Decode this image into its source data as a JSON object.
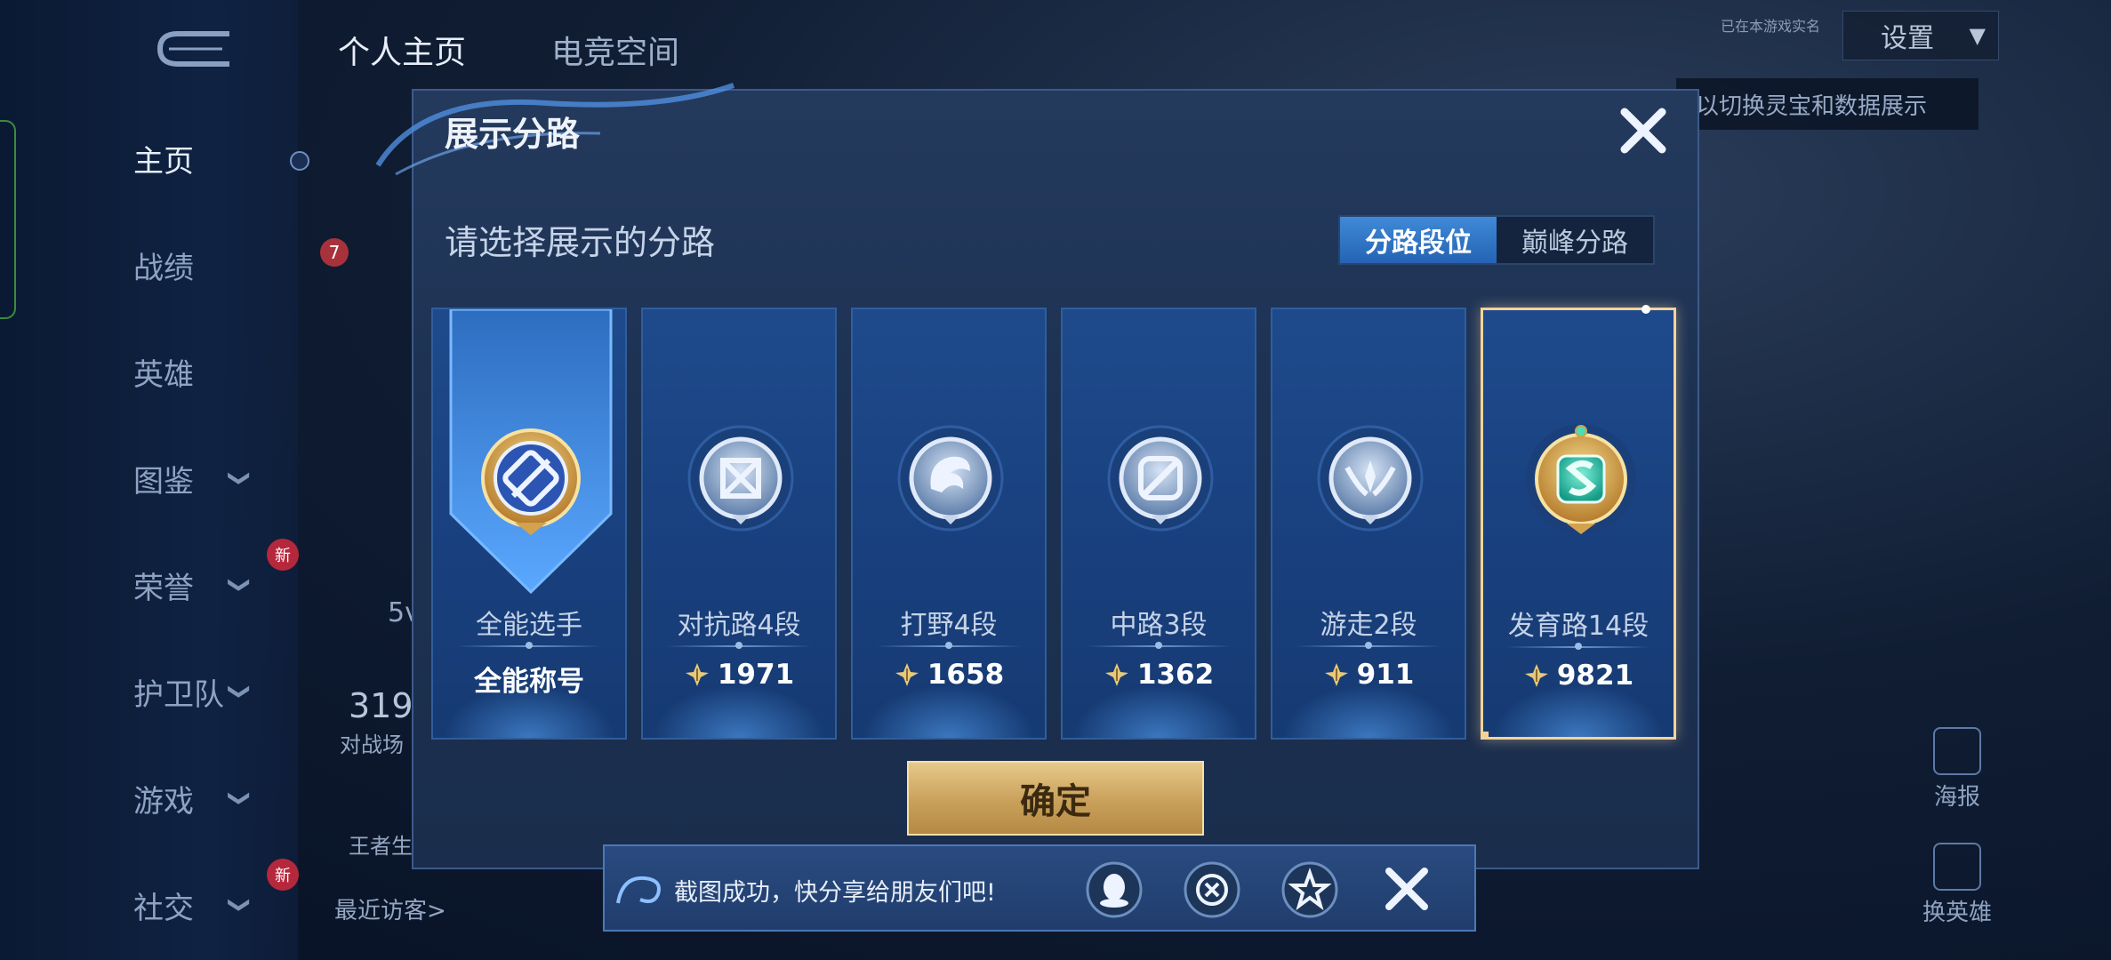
{
  "background": {
    "top_tabs": [
      "个人主页",
      "电竞空间"
    ],
    "nav_items": [
      {
        "label": "主页",
        "chevron": false,
        "new": false
      },
      {
        "label": "战绩",
        "chevron": false,
        "new": false
      },
      {
        "label": "英雄",
        "chevron": false,
        "new": false
      },
      {
        "label": "图鉴",
        "chevron": true,
        "new": false
      },
      {
        "label": "荣誉",
        "chevron": true,
        "new": true
      },
      {
        "label": "护卫队",
        "chevron": true,
        "new": false
      },
      {
        "label": "游戏",
        "chevron": true,
        "new": false
      },
      {
        "label": "社交",
        "chevron": true,
        "new": true
      }
    ],
    "new_badge": "新",
    "settings_label": "设置",
    "realname_text": "已在本游戏实名",
    "tooltip_text": "以切换灵宝和数据展示",
    "stat_count": "319",
    "stat_label": "对战场",
    "level": "7",
    "stat_5v": "5v",
    "brand_text": "王者生",
    "recent_visitors": "最近访客>",
    "right_poster": "海报",
    "right_hero": "换英雄"
  },
  "modal": {
    "title": "展示分路",
    "prompt": "请选择展示的分路",
    "tabs": [
      "分路段位",
      "巅峰分路"
    ],
    "active_tab": 0,
    "cards": [
      {
        "name": "全能选手",
        "value": "全能称号",
        "has_points_icon": false,
        "emblem": "allround-emblem"
      },
      {
        "name": "对抗路4段",
        "value": "1971",
        "has_points_icon": true,
        "emblem": "clash-lane-emblem"
      },
      {
        "name": "打野4段",
        "value": "1658",
        "has_points_icon": true,
        "emblem": "jungle-emblem"
      },
      {
        "name": "中路3段",
        "value": "1362",
        "has_points_icon": true,
        "emblem": "mid-lane-emblem"
      },
      {
        "name": "游走2段",
        "value": "911",
        "has_points_icon": true,
        "emblem": "roam-emblem"
      },
      {
        "name": "发育路14段",
        "value": "9821",
        "has_points_icon": true,
        "emblem": "farm-lane-emblem"
      }
    ],
    "selected_card": 5,
    "confirm_label": "确定"
  },
  "share_bar": {
    "message": "截图成功，快分享给朋友们吧!",
    "icons": [
      "qq-icon",
      "wechat-moments-icon",
      "qzone-icon"
    ]
  }
}
